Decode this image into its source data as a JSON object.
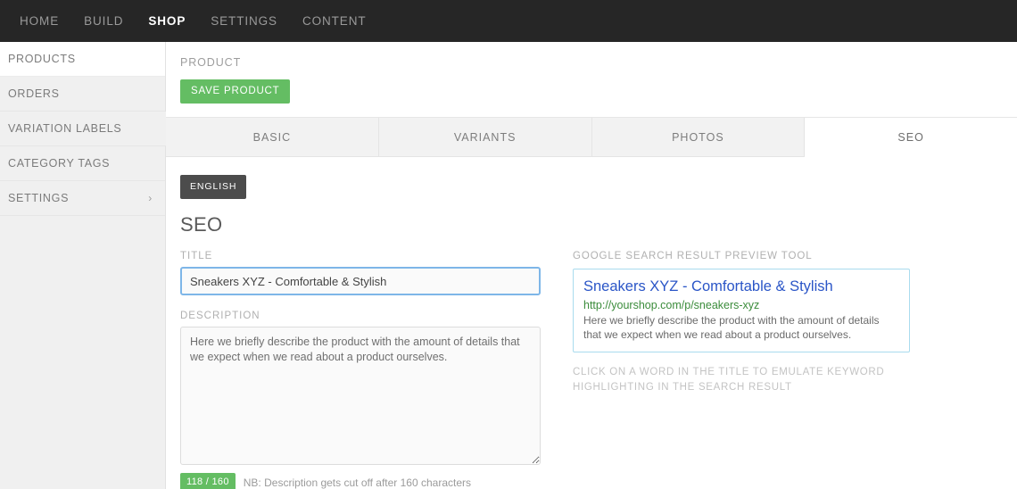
{
  "topnav": {
    "items": [
      {
        "label": "HOME",
        "active": false
      },
      {
        "label": "BUILD",
        "active": false
      },
      {
        "label": "SHOP",
        "active": true
      },
      {
        "label": "SETTINGS",
        "active": false
      },
      {
        "label": "CONTENT",
        "active": false
      }
    ]
  },
  "sidebar": {
    "items": [
      {
        "label": "PRODUCTS"
      },
      {
        "label": "ORDERS"
      },
      {
        "label": "VARIATION LABELS"
      },
      {
        "label": "CATEGORY TAGS"
      },
      {
        "label": "SETTINGS",
        "chevron": "›"
      }
    ]
  },
  "header": {
    "breadcrumb": "PRODUCT",
    "save_label": "SAVE PRODUCT"
  },
  "tabs": [
    {
      "label": "BASIC",
      "active": false
    },
    {
      "label": "VARIANTS",
      "active": false
    },
    {
      "label": "PHOTOS",
      "active": false
    },
    {
      "label": "SEO",
      "active": true
    }
  ],
  "content": {
    "language_button": "ENGLISH",
    "section_title": "SEO",
    "title_field": {
      "label": "TITLE",
      "value": "Sneakers XYZ - Comfortable & Stylish"
    },
    "description_field": {
      "label": "DESCRIPTION",
      "value": "Here we briefly describe the product with the amount of details that we expect when we read about a product ourselves."
    },
    "counter": {
      "badge": "118 / 160",
      "note": "NB: Description gets cut off after 160 characters"
    }
  },
  "preview": {
    "label": "GOOGLE SEARCH RESULT PREVIEW TOOL",
    "title": "Sneakers XYZ - Comfortable & Stylish",
    "url": "http://yourshop.com/p/sneakers-xyz",
    "description": "Here we briefly describe the product with the amount of details that we expect when we read about a product ourselves.",
    "hint": "CLICK ON A WORD IN THE TITLE TO EMULATE KEYWORD HIGHLIGHTING IN THE SEARCH RESULT"
  },
  "colors": {
    "accent_green": "#64bd63",
    "nav_dark": "#262626",
    "focus_blue": "#7eb6e8",
    "link_blue": "#2a55c7",
    "url_green": "#3b8c3b",
    "preview_border": "#a9dbee"
  }
}
